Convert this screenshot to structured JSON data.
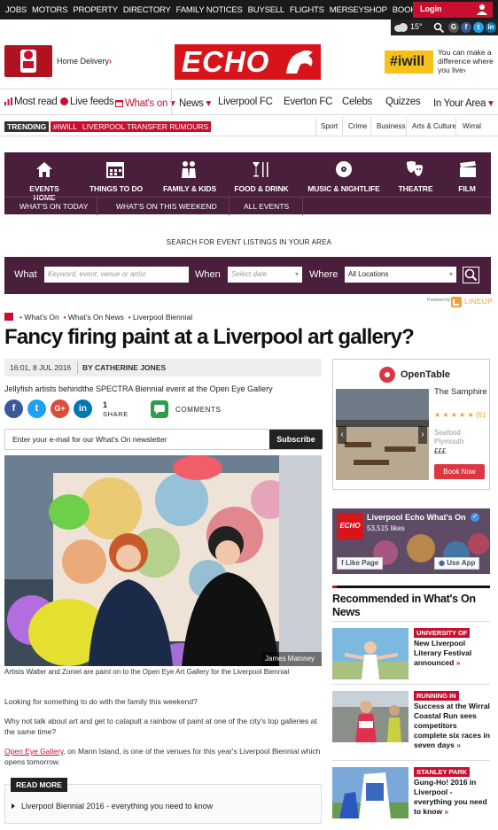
{
  "topbar": {
    "links": [
      "JOBS",
      "MOTORS",
      "PROPERTY",
      "DIRECTORY",
      "FAMILY NOTICES",
      "BUYSELL",
      "FLIGHTS",
      "MERSEYSHOP",
      "BOOK AN AD"
    ],
    "login_label": "Login",
    "temperature": "15°",
    "social": [
      "G",
      "f",
      "t",
      "in"
    ]
  },
  "header": {
    "home_delivery": "Home Delivery",
    "logo_text": "ECHO",
    "iwill_label": "#iwill",
    "iwill_text": "You can make a difference where you live"
  },
  "nav": {
    "items": [
      "Most read",
      "Live feeds",
      "What's on",
      "News",
      "Liverpool FC",
      "Everton FC",
      "Celebs",
      "Quizzes",
      "In Your Area"
    ]
  },
  "trending": {
    "label": "TRENDING",
    "tags": [
      "#IWILL",
      "LIVERPOOL TRANSFER RUMOURS"
    ],
    "subnav": [
      "Sport",
      "Crime",
      "Business",
      "Arts & Culture",
      "Wirral"
    ]
  },
  "events": {
    "categories": [
      "EVENTS HOME",
      "THINGS TO DO",
      "FAMILY & KIDS",
      "FOOD & DRINK",
      "MUSIC & NIGHTLIFE",
      "THEATRE",
      "FILM"
    ],
    "quick_links": [
      "WHAT'S ON TODAY",
      "WHAT'S ON THIS WEEKEND",
      "ALL EVENTS"
    ]
  },
  "search": {
    "heading": "SEARCH FOR EVENT LISTINGS IN YOUR AREA",
    "what_label": "What",
    "what_placeholder": "Keyword, event, venue or artist",
    "when_label": "When",
    "when_placeholder": "Select date",
    "where_label": "Where",
    "where_value": "All Locations",
    "powered_by": "Powered by",
    "lineup": "LINEUP"
  },
  "breadcrumb": [
    "What's On",
    "What's On News",
    "Liverpool Biennial"
  ],
  "article": {
    "headline": "Fancy firing paint at a Liverpool art gallery?",
    "timestamp": "16:01, 8 JUL 2016",
    "byline": "BY CATHERINE JONES",
    "standfirst": "Jellyfish artists behindthe SPECTRA Biennial event at the Open Eye Gallery",
    "share_count": "1",
    "share_label": "SHARE",
    "comments_label": "COMMENTS",
    "newsletter_placeholder": "Enter your e-mail for our What's On newsletter",
    "subscribe_label": "Subscribe",
    "photo_credit": "James Maloney",
    "caption": "Artists Walter and Zoniel are paint on to the Open Eye Art Gallery for the Liverpool Biennial",
    "para1": "Looking for something to do with the family this weekend?",
    "para2": "Why not talk about art and get to catapult a rainbow of paint at one of the city's top galleries at the same time?",
    "para3_link": "Open Eye Gallery",
    "para3_rest": ", on Mann Island, is one of the venues for this year's Liverpool Biennial which opens tomorrow.",
    "read_more_label": "READ MORE",
    "read_more_link": "Liverpool Biennial 2016 - everything you need to know"
  },
  "opentable": {
    "brand": "OpenTable",
    "restaurant": "The Samphire",
    "stars": "★ ★ ★ ★ ★ (61",
    "cuisine": "Seafood",
    "location": "Plymouth",
    "price": "£££",
    "book_label": "Book Now"
  },
  "facebook": {
    "page_name": "Liverpool Echo What's On",
    "likes": "53,515 likes",
    "like_page": "Like Page",
    "use_app": "Use App"
  },
  "recommended": {
    "title": "Recommended in What's On News",
    "items": [
      {
        "tag": "UNIVERSITY OF",
        "text": "New Liverpool Literary Festival announced"
      },
      {
        "tag": "RUNNING IN",
        "text": "Success at the Wirral Coastal Run sees competitors complete six races in seven days"
      },
      {
        "tag": "STANLEY PARK",
        "text": "Gung-Ho! 2016 in Liverpool - everything you need to know"
      }
    ]
  }
}
